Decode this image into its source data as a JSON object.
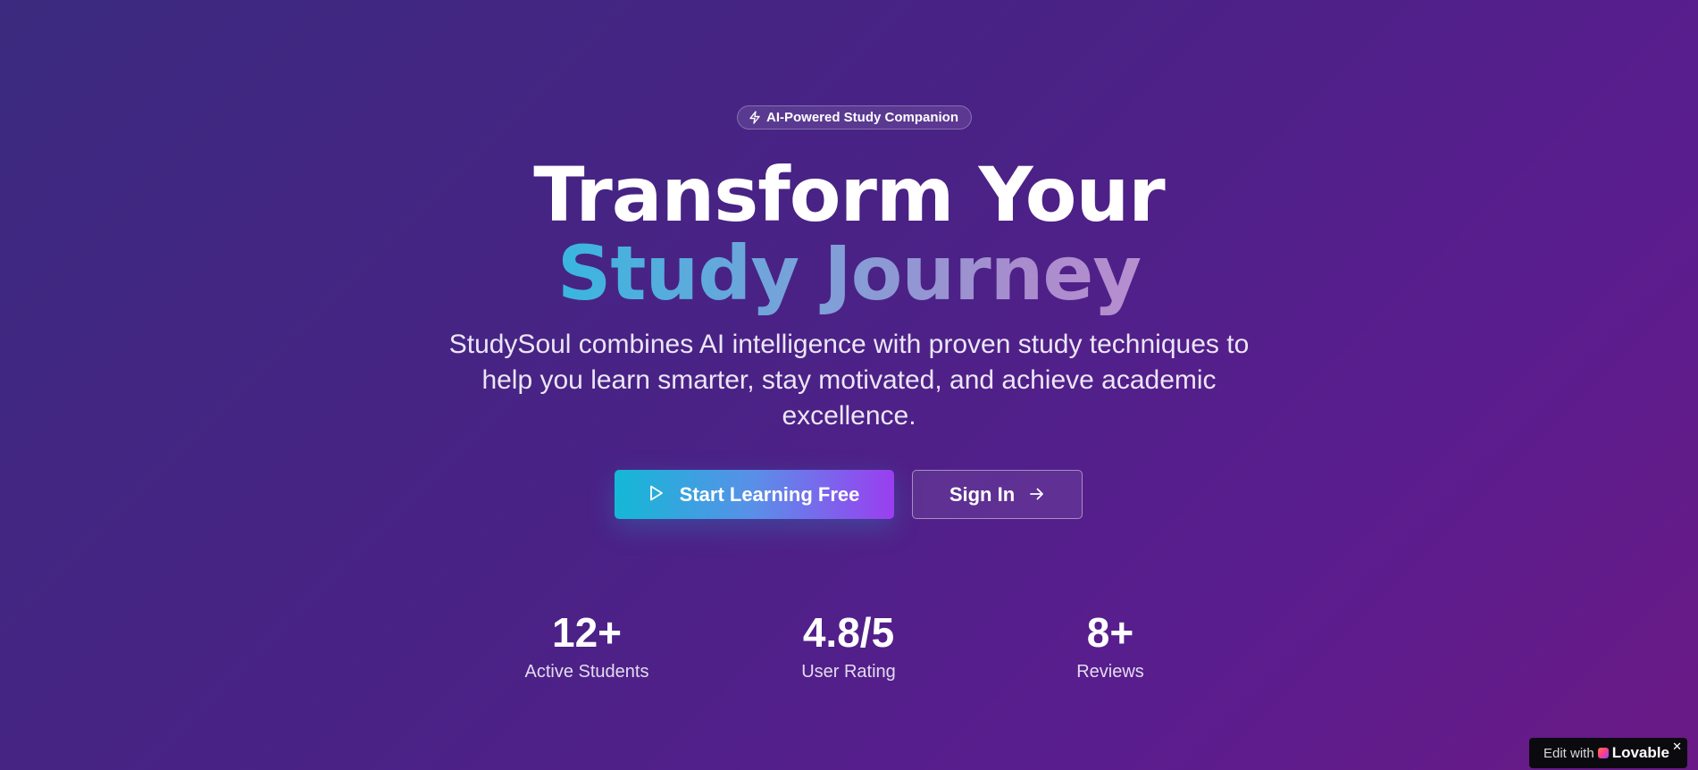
{
  "hero": {
    "badge": {
      "icon": "lightning-icon",
      "label": "AI-Powered Study Companion"
    },
    "headline_line1": "Transform Your",
    "headline_line2": "Study Journey",
    "description": "StudySoul combines AI intelligence with proven study techniques to help you learn smarter, stay motivated, and achieve academic excellence.",
    "primary_button": {
      "icon": "play-icon",
      "label": "Start Learning Free"
    },
    "secondary_button": {
      "label": "Sign In",
      "icon": "arrow-right-icon"
    }
  },
  "stats": [
    {
      "value": "12+",
      "label": "Active Students"
    },
    {
      "value": "4.8/5",
      "label": "User Rating"
    },
    {
      "value": "8+",
      "label": "Reviews"
    }
  ],
  "lovable_badge": {
    "prefix": "Edit with",
    "brand": "Lovable",
    "close": "✕"
  },
  "colors": {
    "background_start": "#3b2a7f",
    "background_end": "#6a1a86",
    "gradient_text_start": "#38b6e0",
    "gradient_text_end": "#b78fcf",
    "primary_button_start": "#14b8d6",
    "primary_button_end": "#9a3ef0"
  }
}
